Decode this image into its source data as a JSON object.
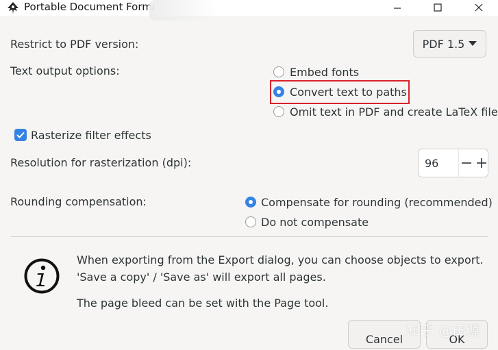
{
  "window": {
    "title": "Portable Document Format",
    "controls": {
      "minimize": "—",
      "maximize": "☐",
      "close": "✕"
    }
  },
  "pdf_version": {
    "label": "Restrict to PDF version:",
    "value": "PDF 1.5"
  },
  "text_output": {
    "label": "Text output options:",
    "options": [
      {
        "label": "Embed fonts",
        "selected": false
      },
      {
        "label": "Convert text to paths",
        "selected": true
      },
      {
        "label": "Omit text in PDF and create LaTeX file",
        "selected": false
      }
    ]
  },
  "rasterize": {
    "label": "Rasterize filter effects",
    "checked": true
  },
  "resolution": {
    "label": "Resolution for rasterization (dpi):",
    "value": "96"
  },
  "rounding": {
    "label": "Rounding compensation:",
    "options": [
      {
        "label": "Compensate for rounding (recommended)",
        "selected": true
      },
      {
        "label": "Do not compensate",
        "selected": false
      }
    ]
  },
  "info": {
    "line1": "When exporting from the Export dialog, you can choose objects to export.",
    "line2": "'Save a copy' / 'Save as' will export all pages.",
    "line3": "The page bleed can be set with the Page tool."
  },
  "buttons": {
    "cancel": "Cancel",
    "ok": "OK"
  },
  "watermark": "知乎 @田源",
  "colors": {
    "accent": "#3584e4",
    "highlight_border": "#d8232a"
  }
}
